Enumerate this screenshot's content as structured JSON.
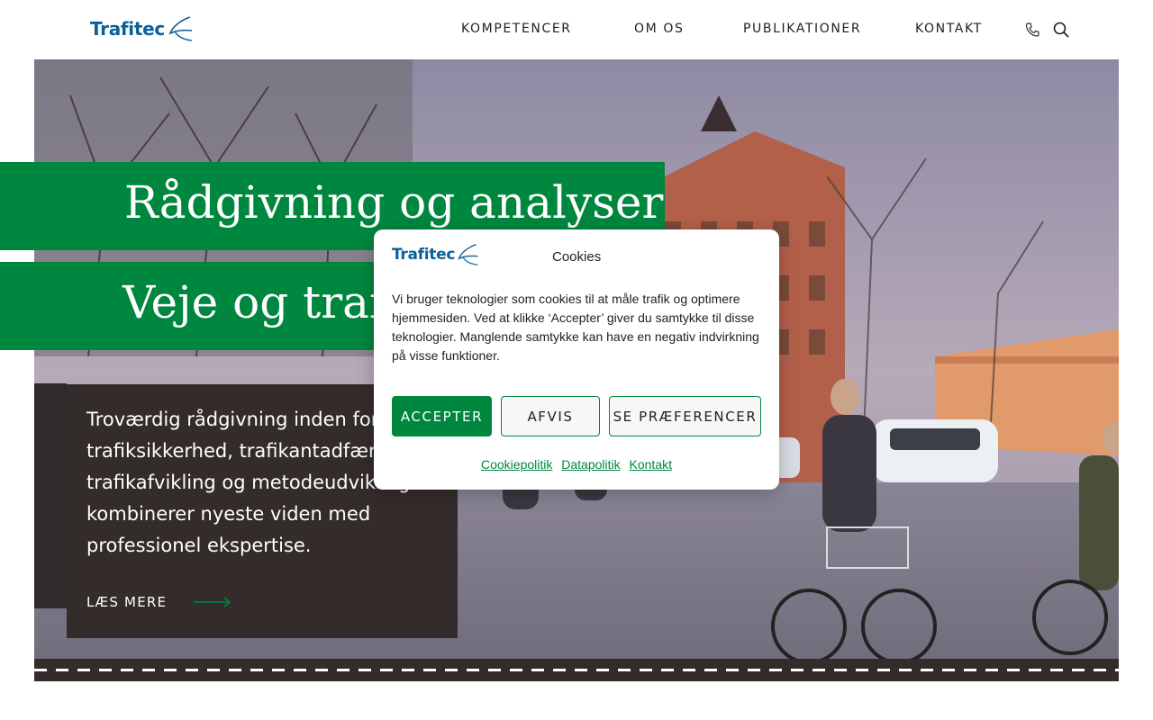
{
  "header": {
    "logo_text": "Trafitec",
    "nav": [
      {
        "label": "KOMPETENCER"
      },
      {
        "label": "OM OS"
      },
      {
        "label": "PUBLIKATIONER"
      },
      {
        "label": "KONTAKT"
      }
    ],
    "icons": [
      "phone-icon",
      "search-icon"
    ]
  },
  "hero": {
    "headline_1": "Rådgivning og analyser",
    "headline_2": "Veje og trafik",
    "body": "Troværdig rådgivning inden for trafiksikkerhed, trafikantadfærd, trafikafvikling og metodeudvikling. Vi kombinerer nyeste viden med professionel ekspertise.",
    "read_more": "LÆS MERE"
  },
  "cookie_dialog": {
    "logo_text": "Trafitec",
    "title": "Cookies",
    "text": "Vi bruger teknologier som cookies til at måle trafik og optimere hjemmesiden. Ved at klikke ‘Accepter’ giver du samtykke til disse teknologier. Manglende samtykke kan have en negativ indvirkning på visse funktioner.",
    "accept": "ACCEPTER",
    "reject": "AFVIS",
    "preferences": "SE PRÆFERENCER",
    "links": [
      "Cookiepolitik",
      "Datapolitik",
      "Kontakt"
    ]
  },
  "colors": {
    "brand_green": "#00873f",
    "brand_blue": "#0b5f9a",
    "dark_brown": "#342c2a"
  }
}
